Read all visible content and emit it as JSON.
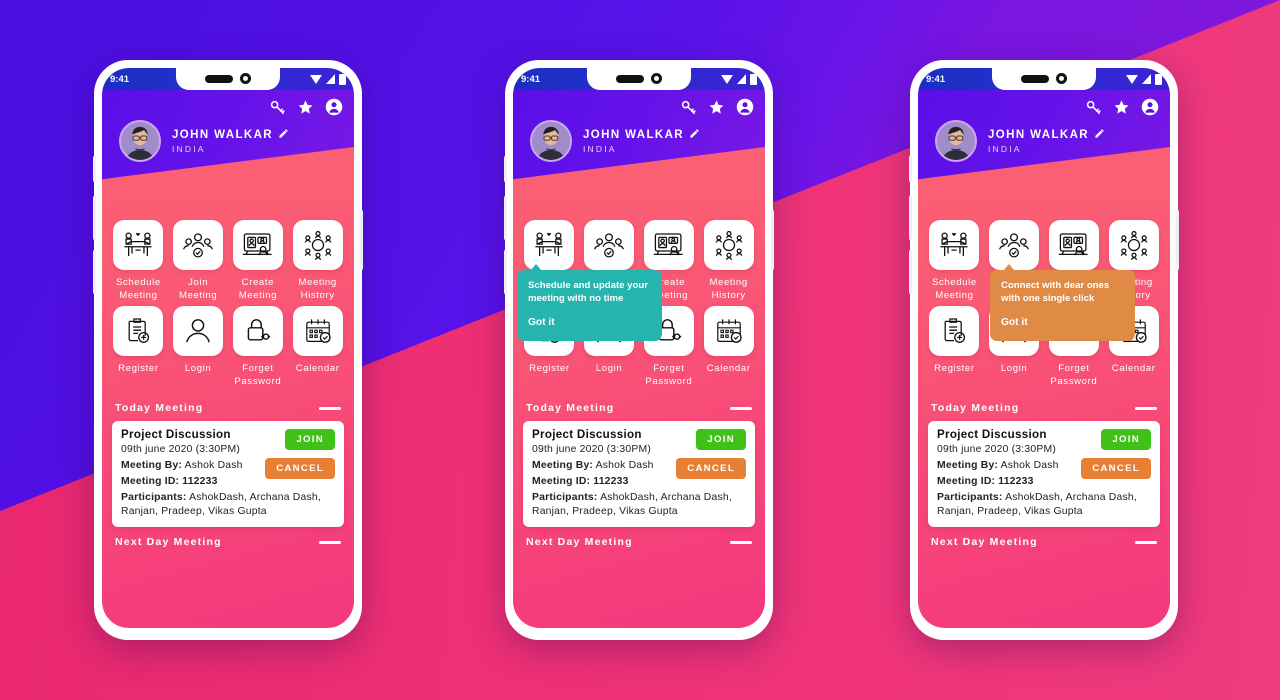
{
  "status_bar": {
    "time": "9:41",
    "icons": [
      "wifi-icon",
      "signal-icon",
      "battery-icon"
    ]
  },
  "header": {
    "user_name": "JOHN WALKAR",
    "country": "INDIA",
    "edit_icon": "pencil-icon",
    "top_icons": [
      "key-icon",
      "star-icon",
      "account-icon"
    ],
    "avatar": "user-avatar"
  },
  "grid": {
    "items": [
      {
        "label": "Schedule\nMeeting",
        "icon": "meeting-table-icon"
      },
      {
        "label": "Join\nMeeting",
        "icon": "group-check-icon"
      },
      {
        "label": "Create\nMeeting",
        "icon": "video-call-icon"
      },
      {
        "label": "Meeting\nHistory",
        "icon": "round-table-icon"
      },
      {
        "label": "Register",
        "icon": "clipboard-plus-icon"
      },
      {
        "label": "Login",
        "icon": "person-icon"
      },
      {
        "label": "Forget\nPassword",
        "icon": "lock-key-icon"
      },
      {
        "label": "Calendar",
        "icon": "calendar-check-icon"
      }
    ]
  },
  "today_meeting": {
    "section_title": "Today Meeting",
    "collapse_icon": "dash-icon",
    "title": "Project Discussion",
    "datetime": "09th june 2020 (3:30PM)",
    "meeting_by_label": "Meeting By:",
    "meeting_by_value": "Ashok Dash",
    "meeting_id_label": "Meeting ID:",
    "meeting_id_value": "112233",
    "participants_label": "Participants:",
    "participants_value": "AshokDash, Archana Dash, Ranjan, Pradeep, Vikas Gupta",
    "join_label": "JOIN",
    "cancel_label": "CANCEL"
  },
  "next_meeting": {
    "section_title": "Next Day Meeting",
    "collapse_icon": "dash-icon"
  },
  "tooltips": {
    "schedule": {
      "text": "Schedule and update your meeting with no time",
      "action": "Got it",
      "color": "#26b5ae"
    },
    "join": {
      "text": "Connect with dear ones with one single click",
      "action": "Got it",
      "color": "#e08b45"
    }
  },
  "colors": {
    "page_purple": "#5712e8",
    "page_pink": "#ee2f74",
    "header_purple": "#6412ea",
    "body_pink": "#f84a78",
    "join_green": "#3fc118",
    "cancel_orange": "#e78034"
  }
}
